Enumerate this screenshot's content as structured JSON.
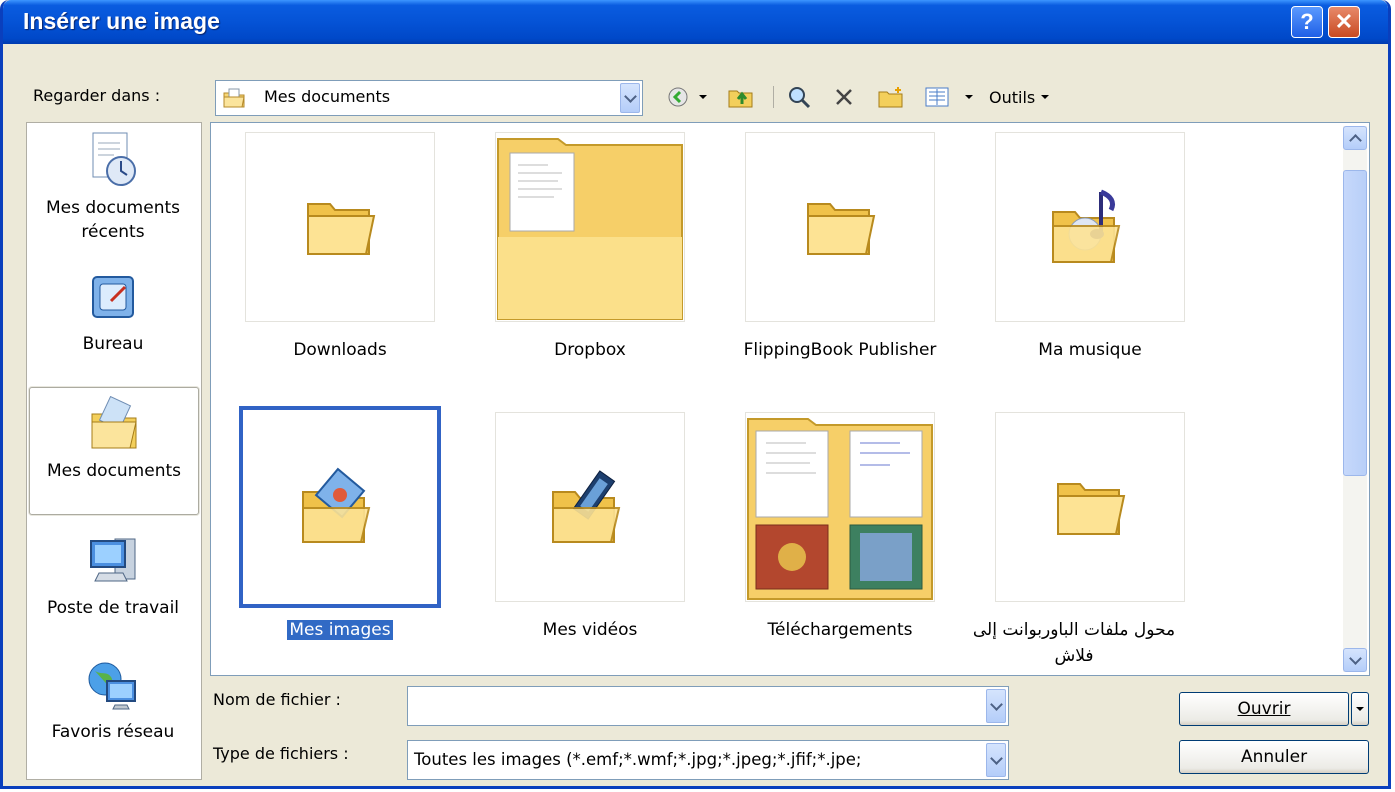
{
  "window": {
    "title": "Insérer une image",
    "help_glyph": "?",
    "close_glyph": "✕"
  },
  "lookin": {
    "label": "Regarder dans :",
    "value": "Mes documents"
  },
  "toolbar": {
    "tools_label": "Outils"
  },
  "places": [
    {
      "label": "Mes documents récents",
      "icon": "recent-documents-icon"
    },
    {
      "label": "Bureau",
      "icon": "desktop-icon"
    },
    {
      "label": "Mes documents",
      "icon": "my-documents-icon",
      "selected": true
    },
    {
      "label": "Poste de travail",
      "icon": "my-computer-icon"
    },
    {
      "label": "Favoris réseau",
      "icon": "network-places-icon"
    }
  ],
  "items": [
    {
      "name": "Downloads",
      "icon": "folder-icon"
    },
    {
      "name": "Dropbox",
      "icon": "folder-preview-icon"
    },
    {
      "name": "FlippingBook Publisher",
      "icon": "folder-icon"
    },
    {
      "name": "Ma musique",
      "icon": "music-folder-icon"
    },
    {
      "name": "Mes images",
      "icon": "pictures-folder-icon",
      "selected": true
    },
    {
      "name": "Mes vidéos",
      "icon": "videos-folder-icon"
    },
    {
      "name": "Téléchargements",
      "icon": "folder-preview-icon"
    },
    {
      "name": "محول ملفات الباوربوانت إلى فلاش",
      "icon": "folder-icon"
    }
  ],
  "filename": {
    "label": "Nom de fichier :",
    "value": ""
  },
  "filetype": {
    "label": "Type de fichiers :",
    "value": "Toutes les images (*.emf;*.wmf;*.jpg;*.jpeg;*.jfif;*.jpe;"
  },
  "buttons": {
    "open": "Ouvrir",
    "cancel": "Annuler"
  },
  "colors": {
    "title_bar": "#0553d6",
    "selection": "#316ac5",
    "dialog_bg": "#ece9d8"
  }
}
